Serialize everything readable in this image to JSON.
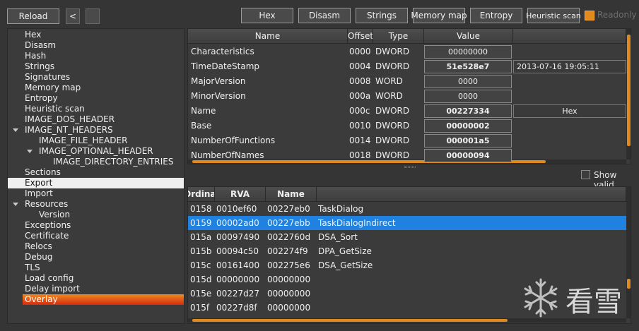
{
  "toolbar": {
    "reload": "Reload",
    "back": "<",
    "hex": "Hex",
    "disasm": "Disasm",
    "strings": "Strings",
    "memory_map": "Memory map",
    "entropy": "Entropy",
    "heuristic_scan": "Heuristic scan",
    "readonly": "Readonly",
    "accent": "#e08a1e"
  },
  "tree": {
    "items": [
      {
        "label": "Hex",
        "level": 0
      },
      {
        "label": "Disasm",
        "level": 0
      },
      {
        "label": "Hash",
        "level": 0
      },
      {
        "label": "Strings",
        "level": 0
      },
      {
        "label": "Signatures",
        "level": 0
      },
      {
        "label": "Memory map",
        "level": 0
      },
      {
        "label": "Entropy",
        "level": 0
      },
      {
        "label": "Heuristic scan",
        "level": 0
      },
      {
        "label": "IMAGE_DOS_HEADER",
        "level": 0
      },
      {
        "label": "IMAGE_NT_HEADERS",
        "level": 0,
        "expanded": true
      },
      {
        "label": "IMAGE_FILE_HEADER",
        "level": 1
      },
      {
        "label": "IMAGE_OPTIONAL_HEADER",
        "level": 1,
        "expanded": true
      },
      {
        "label": "IMAGE_DIRECTORY_ENTRIES",
        "level": 2
      },
      {
        "label": "Sections",
        "level": 0
      },
      {
        "label": "Export",
        "level": 0,
        "selected": true
      },
      {
        "label": "Import",
        "level": 0
      },
      {
        "label": "Resources",
        "level": 0,
        "expanded": true
      },
      {
        "label": "Version",
        "level": 1
      },
      {
        "label": "Exceptions",
        "level": 0
      },
      {
        "label": "Certificate",
        "level": 0
      },
      {
        "label": "Relocs",
        "level": 0
      },
      {
        "label": "Debug",
        "level": 0
      },
      {
        "label": "TLS",
        "level": 0
      },
      {
        "label": "Load config",
        "level": 0
      },
      {
        "label": "Delay import",
        "level": 0
      },
      {
        "label": "Overlay",
        "level": 0,
        "highlight": true
      }
    ]
  },
  "header_table": {
    "columns": [
      "Name",
      "Offset",
      "Type",
      "Value"
    ],
    "rows": [
      {
        "name": "Characteristics",
        "offset": "0000",
        "type": "DWORD",
        "value": "00000000",
        "bold": false,
        "extra": ""
      },
      {
        "name": "TimeDateStamp",
        "offset": "0004",
        "type": "DWORD",
        "value": "51e528e7",
        "bold": true,
        "extra": "2013-07-16 19:05:11"
      },
      {
        "name": "MajorVersion",
        "offset": "0008",
        "type": "WORD",
        "value": "0000",
        "bold": false,
        "extra": ""
      },
      {
        "name": "MinorVersion",
        "offset": "000a",
        "type": "WORD",
        "value": "0000",
        "bold": false,
        "extra": ""
      },
      {
        "name": "Name",
        "offset": "000c",
        "type": "DWORD",
        "value": "00227334",
        "bold": true,
        "extra_button": "Hex"
      },
      {
        "name": "Base",
        "offset": "0010",
        "type": "DWORD",
        "value": "00000002",
        "bold": true,
        "extra": ""
      },
      {
        "name": "NumberOfFunctions",
        "offset": "0014",
        "type": "DWORD",
        "value": "000001a5",
        "bold": true,
        "extra": ""
      },
      {
        "name": "NumberOfNames",
        "offset": "0018",
        "type": "DWORD",
        "value": "00000094",
        "bold": true,
        "extra": ""
      }
    ]
  },
  "show_valid": "Show valid",
  "export_table": {
    "columns": [
      "Ordinal",
      "RVA",
      "Name",
      ""
    ],
    "rows": [
      {
        "ordinal": "0158",
        "rva": "0010ef60",
        "name": "00227eb0",
        "func": "TaskDialog"
      },
      {
        "ordinal": "0159",
        "rva": "00002ad0",
        "name": "00227ebb",
        "func": "TaskDialogIndirect",
        "selected": true
      },
      {
        "ordinal": "015a",
        "rva": "00097490",
        "name": "0022760d",
        "func": "DSA_Sort"
      },
      {
        "ordinal": "015b",
        "rva": "00094c50",
        "name": "002274f9",
        "func": "DPA_GetSize"
      },
      {
        "ordinal": "015c",
        "rva": "00161400",
        "name": "002275e6",
        "func": "DSA_GetSize"
      },
      {
        "ordinal": "015d",
        "rva": "00000000",
        "name": "00000000",
        "func": ""
      },
      {
        "ordinal": "015e",
        "rva": "00227d27",
        "name": "00000000",
        "func": ""
      },
      {
        "ordinal": "015f",
        "rva": "00227d8f",
        "name": "00000000",
        "func": ""
      }
    ]
  },
  "watermark": {
    "text": "看雪",
    "icon": "snowflake-icon"
  }
}
